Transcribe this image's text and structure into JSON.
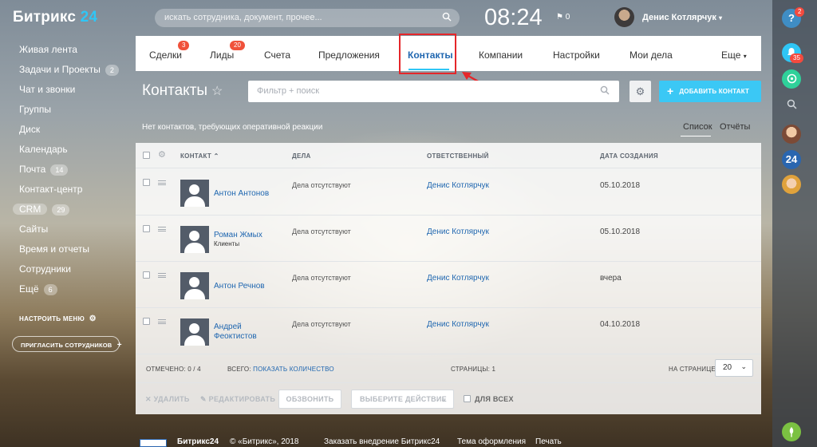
{
  "header": {
    "logo_main": "Битрикс",
    "logo_num": " 24",
    "search_placeholder": "искать сотрудника, документ, прочее...",
    "time": "08:24",
    "flag_count": "0",
    "user_name": "Денис Котлярчук"
  },
  "sidebar": {
    "items": [
      {
        "label": "Живая лента",
        "badge": ""
      },
      {
        "label": "Задачи и Проекты",
        "badge": "2"
      },
      {
        "label": "Чат и звонки",
        "badge": ""
      },
      {
        "label": "Группы",
        "badge": ""
      },
      {
        "label": "Диск",
        "badge": ""
      },
      {
        "label": "Календарь",
        "badge": ""
      },
      {
        "label": "Почта",
        "badge": "14"
      },
      {
        "label": "Контакт-центр",
        "badge": ""
      },
      {
        "label": "CRM",
        "badge": "29"
      },
      {
        "label": "Сайты",
        "badge": ""
      },
      {
        "label": "Время и отчеты",
        "badge": ""
      },
      {
        "label": "Сотрудники",
        "badge": ""
      },
      {
        "label": "Ещё",
        "badge": "6"
      }
    ],
    "setup_menu": "НАСТРОИТЬ МЕНЮ",
    "invite": "ПРИГЛАСИТЬ СОТРУДНИКОВ"
  },
  "rail": {
    "help_label": "?",
    "help_badge": "2",
    "notif_badge": "35",
    "b24_label": "24"
  },
  "tabs": [
    {
      "label": "Сделки",
      "badge": "3"
    },
    {
      "label": "Лиды",
      "badge": "20"
    },
    {
      "label": "Счета",
      "badge": ""
    },
    {
      "label": "Предложения",
      "badge": ""
    },
    {
      "label": "Контакты",
      "badge": ""
    },
    {
      "label": "Компании",
      "badge": ""
    },
    {
      "label": "Настройки",
      "badge": ""
    },
    {
      "label": "Мои дела",
      "badge": ""
    },
    {
      "label": "Еще",
      "badge": ""
    }
  ],
  "toolbar": {
    "title": "Контакты",
    "filter_placeholder": "Фильтр + поиск",
    "add_button": "ДОБАВИТЬ КОНТАКТ"
  },
  "notice": "Нет контактов, требующих оперативной реакции",
  "views": {
    "list": "Список",
    "reports": "Отчёты"
  },
  "grid": {
    "columns": [
      "КОНТАКТ",
      "ДЕЛА",
      "ОТВЕТСТВЕННЫЙ",
      "ДАТА СОЗДАНИЯ"
    ],
    "rows": [
      {
        "name": "Антон Антонов",
        "sub": "",
        "deals": "Дела отсутствуют",
        "responsible": "Денис Котлярчук",
        "date": "05.10.2018"
      },
      {
        "name": "Роман Жмых",
        "sub": "Клиенты",
        "deals": "Дела отсутствуют",
        "responsible": "Денис Котлярчук",
        "date": "05.10.2018"
      },
      {
        "name": "Антон Речнов",
        "sub": "",
        "deals": "Дела отсутствуют",
        "responsible": "Денис Котлярчук",
        "date": "вчера"
      },
      {
        "name": "Андрей Феоктистов",
        "sub": "",
        "deals": "Дела отсутствуют",
        "responsible": "Денис Котлярчук",
        "date": "04.10.2018"
      }
    ],
    "footer": {
      "checked": "ОТМЕЧЕНО: 0 / 4",
      "total_label": "ВСЕГО:",
      "total_link": "ПОКАЗАТЬ КОЛИЧЕСТВО",
      "pages": "СТРАНИЦЫ: 1",
      "per_page_label": "НА СТРАНИЦЕ:",
      "per_page_value": "20"
    },
    "actions": {
      "delete": "УДАЛИТЬ",
      "edit": "РЕДАКТИРОВАТЬ",
      "call": "ОБЗВОНИТЬ",
      "choose": "ВЫБЕРИТЕ ДЕЙСТВИЕ",
      "for_all": "ДЛЯ ВСЕХ"
    }
  },
  "bottom": {
    "logo": "Битрикс24",
    "copyright": "© «Битрикс», 2018",
    "order": "Заказать внедрение Битрикс24",
    "theme": "Тема оформления",
    "print": "Печать"
  }
}
